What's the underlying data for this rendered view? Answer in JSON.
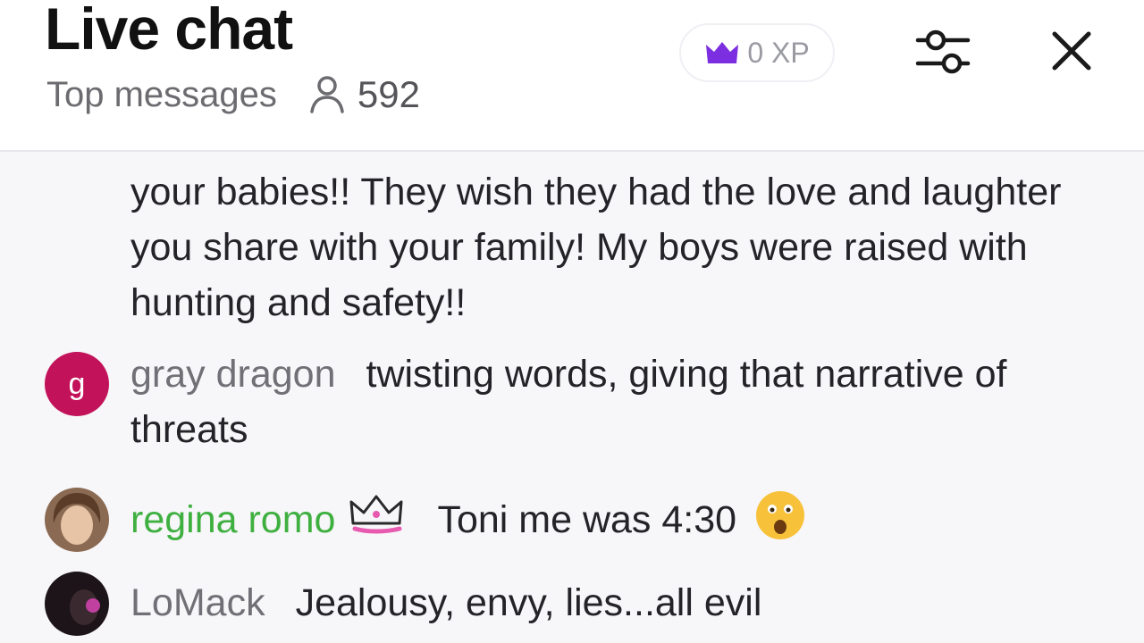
{
  "header": {
    "title": "Live chat",
    "subtitle": "Top messages",
    "viewer_count": "592",
    "xp_label": "0 XP"
  },
  "messages": [
    {
      "author": "",
      "text": "your babies!! They wish they had the love and laughter you share with your family! My boys were raised with hunting and safety!!"
    },
    {
      "author": "gray dragon",
      "avatar_letter": "g",
      "text": "twisting words, giving that narrative of threats"
    },
    {
      "author": "regina romo",
      "text": "Toni me was 4:30"
    },
    {
      "author": "LoMack",
      "text": "Jealousy, envy, lies...all evil"
    }
  ],
  "colors": {
    "accent_purple": "#7b2fe0",
    "author_green": "#3fb040",
    "avatar_g": "#c2125a"
  },
  "icons": [
    "person-icon",
    "crown-icon",
    "sliders-icon",
    "close-icon",
    "crown-badge-icon",
    "astonished-emoji-icon"
  ]
}
